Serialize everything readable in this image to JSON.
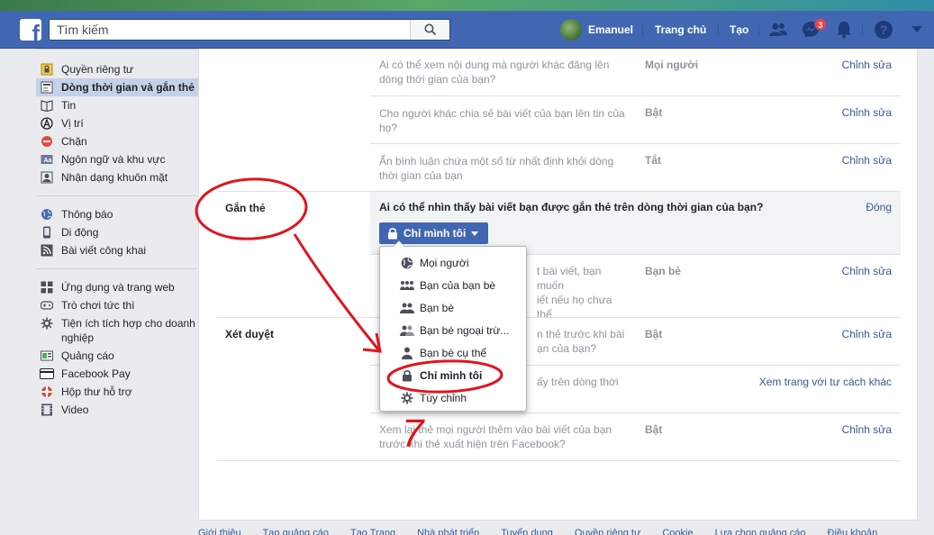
{
  "topbar": {
    "search_placeholder": "Tìm kiếm",
    "user_name": "Emanuel",
    "home": "Trang chủ",
    "create": "Tạo",
    "messages_badge": "3"
  },
  "sidebar": {
    "group1": [
      {
        "label": "Quyền riêng tư",
        "icon": "lock-icon"
      },
      {
        "label": "Dòng thời gian và gắn thẻ",
        "icon": "timeline-icon",
        "active": true
      },
      {
        "label": "Tin",
        "icon": "book-icon"
      },
      {
        "label": "Vị trí",
        "icon": "location-icon"
      },
      {
        "label": "Chặn",
        "icon": "block-icon"
      },
      {
        "label": "Ngôn ngữ và khu vực",
        "icon": "language-icon"
      },
      {
        "label": "Nhận dạng khuôn mặt",
        "icon": "face-icon"
      }
    ],
    "group2": [
      {
        "label": "Thông báo",
        "icon": "globe-icon"
      },
      {
        "label": "Di động",
        "icon": "mobile-icon"
      },
      {
        "label": "Bài viết công khai",
        "icon": "rss-icon"
      }
    ],
    "group3": [
      {
        "label": "Ứng dụng và trang web",
        "icon": "apps-icon"
      },
      {
        "label": "Trò chơi tức thì",
        "icon": "game-icon"
      },
      {
        "label": "Tiện ích tích hợp cho doanh nghiệp",
        "icon": "business-icon"
      },
      {
        "label": "Quảng cáo",
        "icon": "ads-icon"
      },
      {
        "label": "Facebook Pay",
        "icon": "card-icon"
      },
      {
        "label": "Hộp thư hỗ trợ",
        "icon": "support-icon"
      },
      {
        "label": "Video",
        "icon": "video-icon"
      }
    ]
  },
  "rows_top": [
    {
      "question": "Ai có thể xem nội dung mà người khác đăng lên dòng thời gian của bạn?",
      "value": "Mọi người",
      "edit": "Chỉnh sửa"
    },
    {
      "question": "Cho người khác chia sẻ bài viết của bạn lên tin của họ?",
      "value": "Bật",
      "edit": "Chỉnh sửa"
    },
    {
      "question": "Ẩn bình luận chứa một số từ nhất định khỏi dòng thời gian của bạn",
      "value": "Tắt",
      "edit": "Chỉnh sửa"
    }
  ],
  "tagging": {
    "section_label": "Gắn thẻ",
    "expanded_question": "Ai có thể nhìn thấy bài viết bạn được gắn thẻ trên dòng thời gian của bạn?",
    "close": "Đóng",
    "privacy_button": "Chỉ mình tôi",
    "row2_q": "t bài viết, bạn muốn\niết nếu họ chưa thể",
    "row2_v": "Bạn bè",
    "row2_e": "Chỉnh sửa"
  },
  "review": {
    "section_label": "Xét duyệt",
    "row1_q": "n thẻ trước khi bài\nạn của bạn?",
    "row1_v": "Bật",
    "row1_e": "Chỉnh sửa",
    "row2_q": "ấy trên dòng thời",
    "row2_e": "Xem trang với tư cách khác",
    "row3_q": "Xem lại thẻ mọi người thêm vào bài viết của bạn trước khi thẻ xuất hiện trên Facebook?",
    "row3_v": "Bật",
    "row3_e": "Chỉnh sửa"
  },
  "dropdown": {
    "items": [
      {
        "label": "Mọi người",
        "icon": "globe-icon"
      },
      {
        "label": "Bạn của bạn bè",
        "icon": "friends-of-friends-icon"
      },
      {
        "label": "Bạn bè",
        "icon": "friends-icon"
      },
      {
        "label": "Bạn bè ngoại trừ...",
        "icon": "friends-except-icon"
      },
      {
        "label": "Bạn bè cụ thể",
        "icon": "person-icon"
      },
      {
        "label": "Chỉ mình tôi",
        "icon": "lock-icon",
        "selected": true
      },
      {
        "label": "Tùy chỉnh",
        "icon": "gear-icon"
      }
    ]
  },
  "annotation_number": "7",
  "footer": [
    "Giới thiệu",
    "Tạo quảng cáo",
    "Tạo Trang",
    "Nhà phát triển",
    "Tuyển dụng",
    "Quyền riêng tư",
    "Cookie",
    "Lựa chọn quảng cáo",
    "Điều khoản"
  ],
  "colors": {
    "brand": "#4267b2",
    "link": "#365899",
    "annotation": "#e0141e"
  }
}
